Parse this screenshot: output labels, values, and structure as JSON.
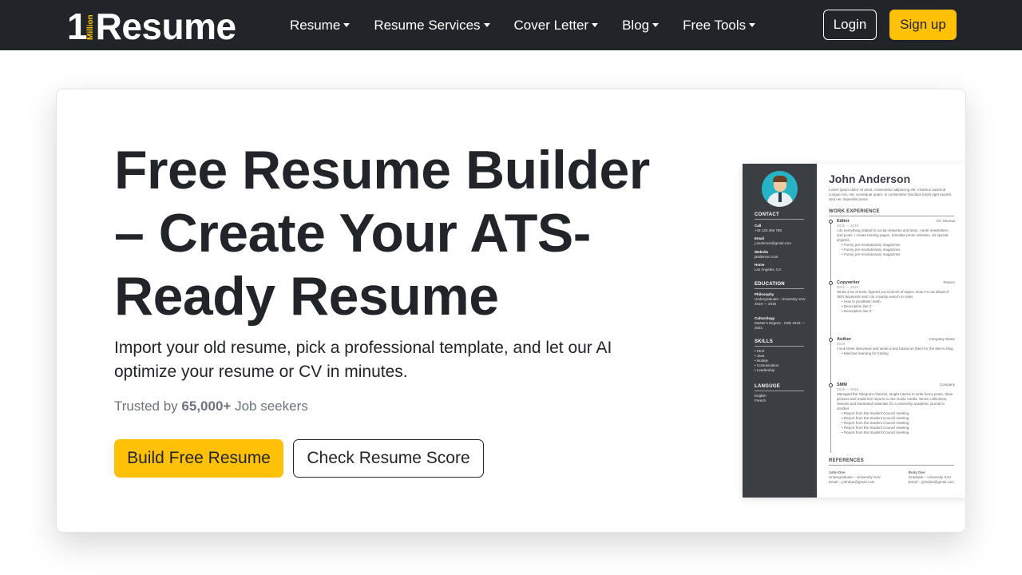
{
  "brand": {
    "one": "1",
    "million": "Million",
    "name": "Resume"
  },
  "nav": {
    "items": [
      {
        "label": "Resume"
      },
      {
        "label": "Resume Services"
      },
      {
        "label": "Cover Letter"
      },
      {
        "label": "Blog"
      },
      {
        "label": "Free Tools"
      }
    ],
    "login_label": "Login",
    "signup_label": "Sign up"
  },
  "hero": {
    "title": "Free Resume Builder – Create Your ATS-Ready Resume",
    "subtitle": "Import your old resume, pick a professional template, and let our AI optimize your resume or CV in minutes.",
    "trust_prefix": "Trusted by ",
    "trust_count": "65,000+",
    "trust_suffix": " Job seekers",
    "primary_button": "Build Free Resume",
    "secondary_button": "Check Resume Score"
  },
  "resume_preview": {
    "name": "John Anderson",
    "intro": "Lorem ipsum dolor sit amet, consectetur adipiscing elit. Vivamus euismod congue nisi, nec consequat quam. In consectetur faucibus turpis eget laoreet. Sed nec imperdiet purus.",
    "contact_heading": "CONTACT",
    "contact": [
      {
        "label": "Call",
        "value": "+34 123 456 789"
      },
      {
        "label": "Email",
        "value": "j.anderson@gmail.com"
      },
      {
        "label": "Website",
        "value": "janderson.com"
      },
      {
        "label": "Home",
        "value": "Los Angeles, CA"
      }
    ],
    "education_heading": "EDUCATION",
    "education": [
      {
        "title": "Philosophy",
        "lines": "Undergraduate - University XAV 2016 — 2019"
      },
      {
        "title": "Culturology",
        "lines": "Master's Degree - HSE 2019 — 2021"
      }
    ],
    "skills_heading": "SKILLS",
    "skills": [
      "• Html",
      "• Java",
      "• Nodejs",
      "• Comunication",
      "• Leadership"
    ],
    "language_heading": "LANGUGE",
    "languages": [
      "English",
      "French"
    ],
    "work_heading": "WORK EXPERIENCE",
    "jobs": [
      {
        "title": "Editor",
        "company": "GC Osnova",
        "dates": "2019 — 2019",
        "desc": "I do everything related to social networks and texts. I write newsletters and posts. I create landing pages, translate press releases, do special projects.",
        "bullets": [
          "• Funny pre-revolutionary magazines",
          "• Funny pre-revolutionary magazines",
          "• Funny pre-revolutionary magazines"
        ]
      },
      {
        "title": "Copywriter",
        "company": "Textero",
        "dates": "2019 — 2019",
        "desc": "Wrote a lot of texts, figured out a bunch of topics. Now I'm not afraid of SEO keywords and I do a sanity search to order.",
        "bullets": [
          "• How to prosthetic teeth",
          "• Description line 2",
          "• Description line 3"
        ]
      },
      {
        "title": "Author",
        "company": "Company Name",
        "dates": "2018",
        "desc": "I took three interviews and wrote a text based on them for the Mel.ru blog.",
        "bullets": [
          "• Machine learning for trading"
        ]
      },
      {
        "title": "SMM",
        "company": "Company",
        "dates": "2016 — 2018",
        "desc": "Managed the Telegram channel, taught interns to write funny posts, drew pictures and made live reports in one studio media. Wrote collections, reviews and translated materials for a university academic journal in another",
        "bullets": [
          "• Report from the Student Council meeting",
          "• Report from the Student Council meeting",
          "• Report from the Student Council meeting",
          "• Report from the Student Council meeting",
          "• Report from the Student Council meeting"
        ]
      }
    ],
    "references_heading": "REFERENCES",
    "references": [
      {
        "name": "John Doe",
        "line1": "Undergraduate – University XAV",
        "line2": "Email – johndoe@gmail.com"
      },
      {
        "name": "Rody Doe",
        "line1": "Graduate – University XAV",
        "line2": "Email – johndoe@gmail.com"
      }
    ]
  },
  "colors": {
    "navbar_bg": "#212529",
    "accent": "#ffc107",
    "resume_sidebar": "#3b3e43",
    "avatar_bg": "#26b3c4"
  }
}
